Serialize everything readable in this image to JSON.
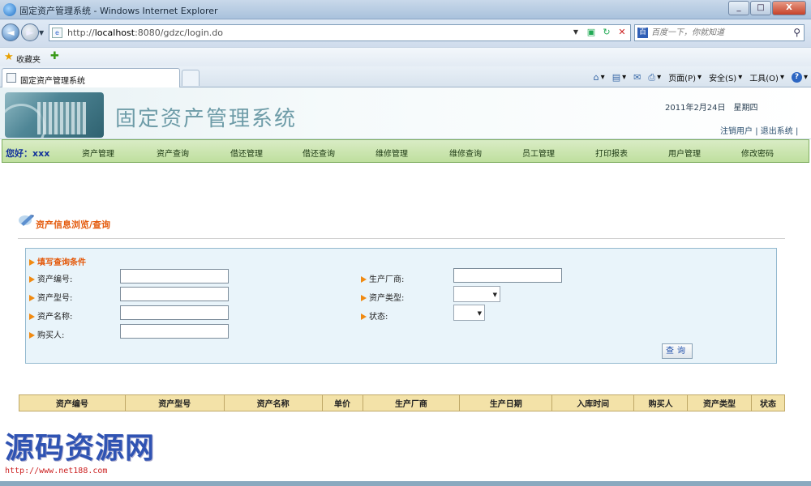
{
  "browser": {
    "window_title": "固定资产管理系统 - Windows Internet Explorer",
    "url_prefix": "http://",
    "url_host": "localhost",
    "url_rest": ":8080/gdzc/login.do",
    "search_placeholder": "百度一下，你就知道",
    "favorites_label": "收藏夹",
    "tab_title": "固定资产管理系统",
    "commands": {
      "page": "页面(P)",
      "safety": "安全(S)",
      "tools": "工具(O)"
    },
    "min_label": "_",
    "max_label": "□",
    "close_label": "X"
  },
  "app": {
    "title": "固定资产管理系统",
    "date": "2011年2月24日　星期四",
    "logout_link": "注销用户",
    "exit_link": "退出系统",
    "link_separator": "|",
    "greeting": "您好：xxx"
  },
  "nav": {
    "items": [
      "资产管理",
      "资产查询",
      "借还管理",
      "借还查询",
      "维修管理",
      "维修查询",
      "员工管理",
      "打印报表",
      "用户管理",
      "修改密码"
    ]
  },
  "section": {
    "title": "资产信息浏览/查询"
  },
  "query": {
    "header": "填写查询条件",
    "labels": {
      "asset_no": "资产编号:",
      "asset_model": "资产型号:",
      "asset_name": "资产名称:",
      "buyer": "购买人:",
      "manufacturer": "生产厂商:",
      "asset_type": "资产类型:",
      "status": "状态:"
    },
    "values": {
      "asset_no": "",
      "asset_model": "",
      "asset_name": "",
      "buyer": "",
      "manufacturer": ""
    },
    "asset_type_selected": "",
    "status_selected": "",
    "button": "查询"
  },
  "table": {
    "headers": [
      "资产编号",
      "资产型号",
      "资产名称",
      "单价",
      "生产厂商",
      "生产日期",
      "入库时间",
      "购买人",
      "资产类型",
      "状态"
    ]
  },
  "watermark": {
    "text": "源码资源网",
    "url": "http://www.net188.com"
  },
  "colors": {
    "nav_bg": "#c6e3a9",
    "accent_orange": "#e45a0c",
    "table_head": "#f3e2a8",
    "query_bg": "#e9f4fa"
  }
}
